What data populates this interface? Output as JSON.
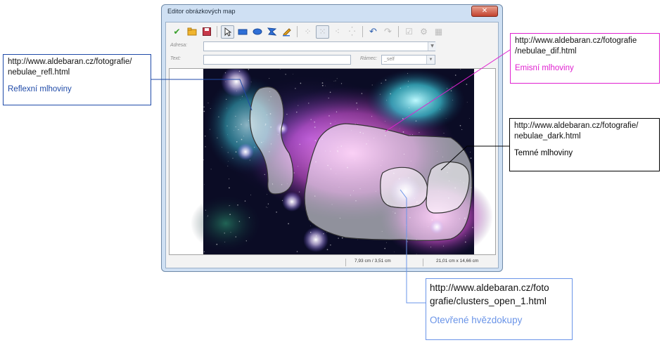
{
  "window": {
    "title": "Editor obrázkových map",
    "close_label": "✕"
  },
  "toolbar": {
    "icons": [
      "apply-icon",
      "open-icon",
      "save-icon",
      "pointer-icon",
      "rectangle-icon",
      "ellipse-icon",
      "polygon-icon",
      "freeform-icon",
      "edit-points-icon",
      "move-points-icon",
      "insert-point-icon",
      "delete-point-icon",
      "undo-icon",
      "redo-icon",
      "active-icon",
      "macro-icon",
      "properties-icon"
    ]
  },
  "fields": {
    "address_label": "Adresa:",
    "address_value": "",
    "text_label": "Text:",
    "text_value": "",
    "frame_label": "Rámec:",
    "frame_value": "_self"
  },
  "status": {
    "position": "7,93 cm / 3,51 cm",
    "size": "21,01 cm x 14,66 cm"
  },
  "callouts": {
    "reflection": {
      "url": "http://www.aldebaran.cz/fotografie/\nnebulae_refl.html",
      "name": "Reflexní mlhoviny",
      "color": "#1f4aa8"
    },
    "emission": {
      "url": "http://www.aldebaran.cz/fotografie\n/nebulae_dif.html",
      "name": "Emisní mlhoviny",
      "color": "#e020d0"
    },
    "dark": {
      "url": "http://www.aldebaran.cz/fotografie/\nnebulae_dark.html",
      "name": "Temné mlhoviny",
      "color": "#000000"
    },
    "clusters": {
      "url": "http://www.aldebaran.cz/foto\ngrafie/clusters_open_1.html",
      "name": "Otevřené hvězdokupy",
      "color": "#6a94e8"
    }
  }
}
